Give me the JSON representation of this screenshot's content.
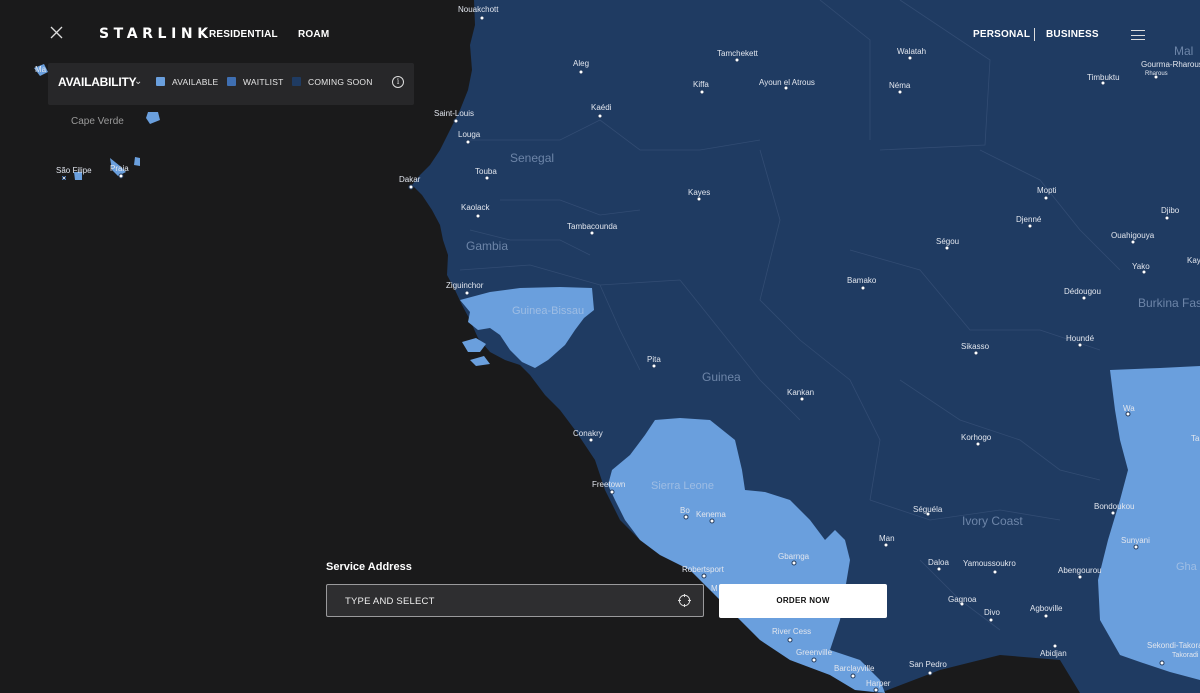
{
  "brand": "STARLINK",
  "nav": {
    "residential": "RESIDENTIAL",
    "roam": "ROAM",
    "personal": "PERSONAL",
    "business": "BUSINESS"
  },
  "legend": {
    "title": "AVAILABILITY",
    "items": [
      {
        "label": "AVAILABLE",
        "color": "#6a9fdd"
      },
      {
        "label": "WAITLIST",
        "color": "#3f6fb2"
      },
      {
        "label": "COMING SOON",
        "color": "#1f3b62"
      }
    ]
  },
  "service": {
    "label": "Service Address",
    "placeholder": "TYPE AND SELECT",
    "order_label": "ORDER NOW"
  },
  "colors": {
    "ocean": "#1a1a1b",
    "coming_soon": "#1f3b62",
    "available": "#6a9fdd"
  },
  "map_labels": {
    "countries": [
      "Senegal",
      "Gambia",
      "Guinea-Bissau",
      "Guinea",
      "Sierra Leone",
      "Ivory Coast",
      "Cape Verde",
      "Burkina Fas",
      "Mal",
      "Gha"
    ],
    "cities": [
      "Nouakchott",
      "Aleg",
      "Tamchekett",
      "Walatah",
      "Kiffa",
      "Ayoun el Atrous",
      "Néma",
      "Timbuktu",
      "Gourma-Rharous",
      "Saint-Louis",
      "Kaédi",
      "Louga",
      "Touba",
      "Dakar",
      "Kaolack",
      "Tambacounda",
      "Kayes",
      "Mopti",
      "Djibo",
      "Djenné",
      "Ouahigouya",
      "Ségou",
      "Yako",
      "Kay",
      "Bamako",
      "Dédougou",
      "Ziguinchor",
      "Houndé",
      "Sikasso",
      "Pita",
      "Kankan",
      "Wa",
      "Ta",
      "Conakry",
      "Korhogo",
      "Freetown",
      "Bo",
      "Kenema",
      "Séguéla",
      "Bondoukou",
      "Man",
      "Sunyani",
      "Gbarnga",
      "Daloa",
      "Yamoussoukro",
      "Abengourou",
      "Robertsport",
      "M",
      "Gagnoa",
      "Divo",
      "Agboville",
      "River Cess",
      "Greenville",
      "Barclayville",
      "Harper",
      "San Pedro",
      "Abidjan",
      "Sekondi-Takoradi",
      "São Filipe",
      "Praia",
      "Ma"
    ]
  }
}
